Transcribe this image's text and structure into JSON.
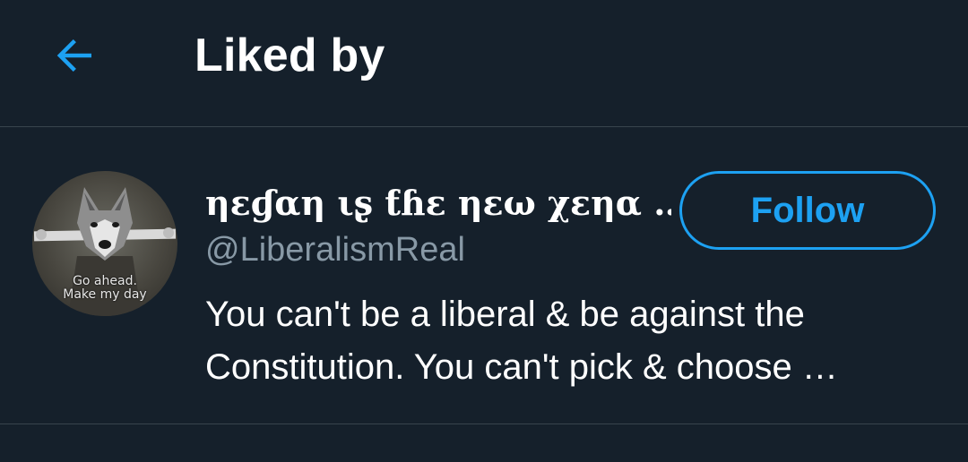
{
  "header": {
    "title": "Liked by",
    "back_icon": "arrow-left-icon"
  },
  "user": {
    "display_name": "ηεɠαη ιʂ ƭɦε ηεω χεηα …",
    "handle": "@LiberalismReal",
    "follow_label": "Follow",
    "avatar_caption_line1": "Go ahead.",
    "avatar_caption_line2": "Make my day",
    "bio_line1": "You can't be a liberal & be against the",
    "bio_line2": "Constitution. You can't pick & choose …"
  },
  "colors": {
    "background": "#15202b",
    "accent": "#1da1f2",
    "secondary_text": "#8899a6",
    "divider": "#38444d"
  }
}
